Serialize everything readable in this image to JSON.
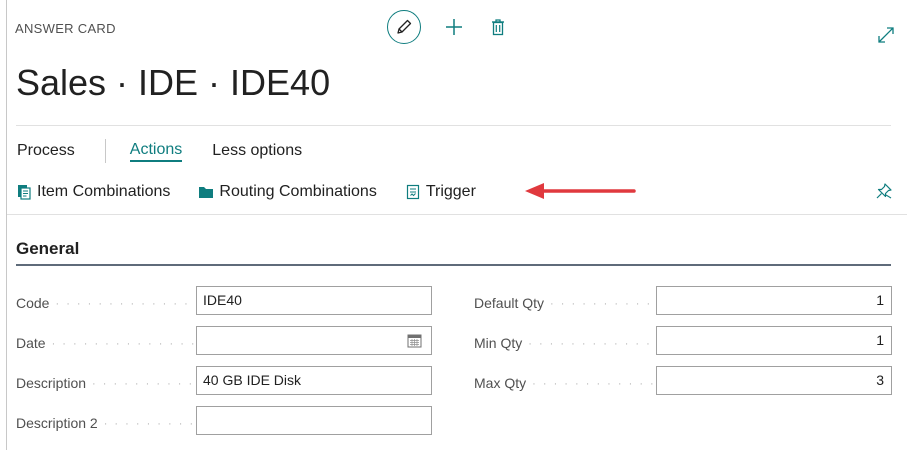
{
  "card": {
    "caption": "ANSWER CARD",
    "title": "Sales · IDE · IDE40"
  },
  "tabs": {
    "process": "Process",
    "actions": "Actions",
    "less_options": "Less options"
  },
  "actions": {
    "item_combinations": "Item Combinations",
    "routing_combinations": "Routing Combinations",
    "trigger": "Trigger"
  },
  "section": {
    "title": "General"
  },
  "fields": {
    "code": {
      "label": "Code",
      "value": "IDE40"
    },
    "date": {
      "label": "Date",
      "value": ""
    },
    "description": {
      "label": "Description",
      "value": "40 GB IDE Disk"
    },
    "description2": {
      "label": "Description 2",
      "value": ""
    },
    "default_qty": {
      "label": "Default Qty",
      "value": "1"
    },
    "min_qty": {
      "label": "Min Qty",
      "value": "1"
    },
    "max_qty": {
      "label": "Max Qty",
      "value": "3"
    }
  },
  "icons": {
    "edit": "pencil-icon",
    "new": "plus-icon",
    "delete": "trash-icon",
    "expand": "expand-icon",
    "pin": "pin-icon",
    "calendar": "calendar-icon"
  },
  "colors": {
    "accent": "#0f7d7f",
    "arrow": "#e0393e"
  }
}
